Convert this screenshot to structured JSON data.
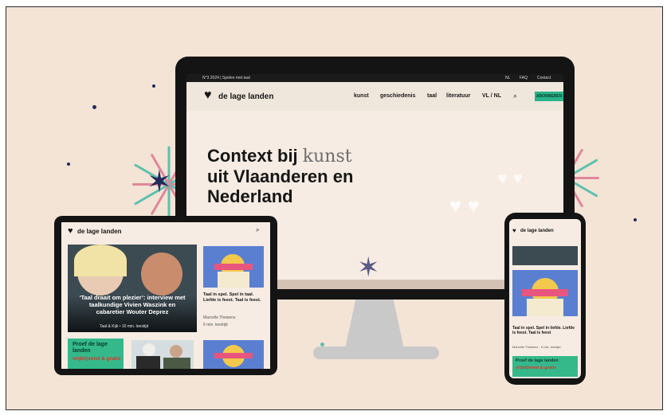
{
  "colors": {
    "background": "#f3e4d6",
    "accent_green": "#28b38a",
    "dark": "#141414",
    "ray_teal": "#5ebfae",
    "ray_pink": "#e0879a",
    "ray_navy": "#23295a"
  },
  "desktop": {
    "topbar_left": "N°3 2024 | Spelen met taal",
    "topbar_right": [
      "NL",
      "FAQ",
      "Contact"
    ],
    "brand": "de lage landen",
    "nav": [
      "kunst",
      "geschiedenis",
      "taal",
      "literatuur",
      "VL / NL"
    ],
    "search_icon": "search-icon",
    "cta_label": "ABONNEREN",
    "hero_line1_a": "Context bij ",
    "hero_line1_keyword": "kunst",
    "hero_line2": "uit Vlaanderen en",
    "hero_line3": "Nederland"
  },
  "tablet": {
    "brand": "de lage landen",
    "feature_caption": "‘Taal draait om plezier’: interview met taalkundige Vivien Waszink en cabaretier Wouter Deprez",
    "feature_meta": "Taal & Kijk   •   10 min. leestijd",
    "card_title": "Taal in spel. Spel in taal. Liefde is feest. Taal is feest.",
    "card_author": "Marcelle Theisens",
    "card_meta": "6 min. leestijd",
    "promo_title": "Proef de lage landen",
    "promo_sub": "vrijblijvend & gratis"
  },
  "phone": {
    "brand": "de lage landen",
    "card_title": "Taal in spel. Spel in liefde. Liefde is feest. Taal is feest",
    "card_author": "Marcelle Theisens",
    "card_meta": "6 min. leestijd",
    "promo_title": "Proef de lage landen",
    "promo_sub": "vrijblijvend & gratis"
  }
}
